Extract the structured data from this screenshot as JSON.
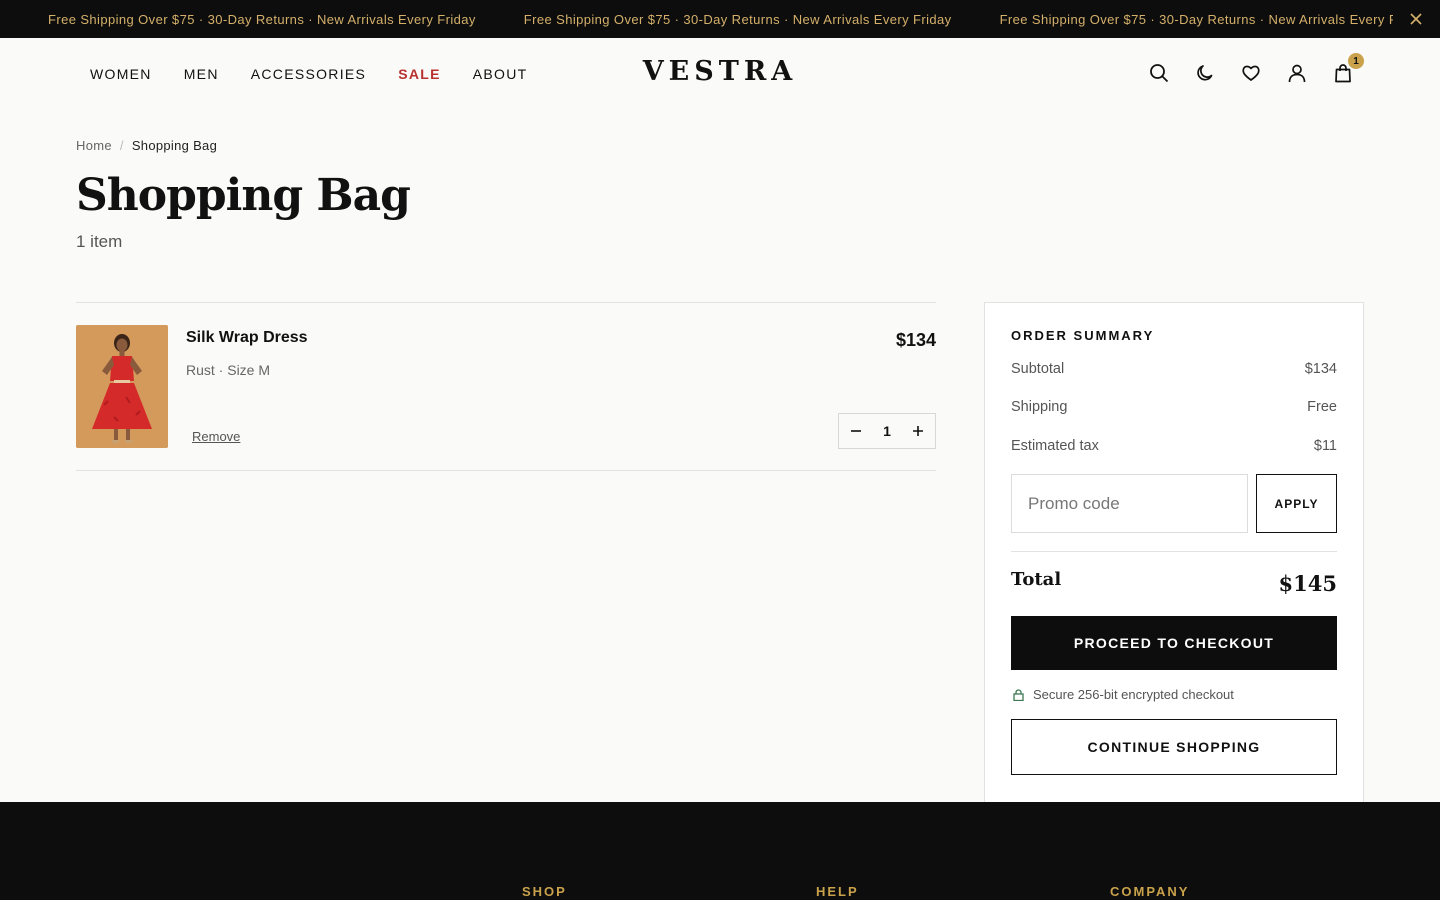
{
  "announcement": {
    "messages": [
      "Free Shipping Over $75 · 30-Day Returns · New Arrivals Every Friday",
      "Free Shipping Over $75 · 30-Day Returns · New Arrivals Every Friday",
      "Free Shipping Over $75 · 30-Day Returns · New Arrivals Every Friday"
    ],
    "close_icon": "close-icon"
  },
  "nav": {
    "items": [
      "WOMEN",
      "MEN",
      "ACCESSORIES",
      "SALE",
      "ABOUT"
    ]
  },
  "brand": {
    "logo": "VESTRA"
  },
  "header_icons": {
    "icons": [
      "search-icon",
      "moon-icon",
      "heart-icon",
      "user-icon",
      "bag-icon"
    ],
    "cart_count": "1"
  },
  "breadcrumb": {
    "home": "Home",
    "separator": "/",
    "current": "Shopping Bag"
  },
  "page": {
    "title": "Shopping Bag",
    "item_count": "1 item"
  },
  "cart": {
    "items": [
      {
        "name": "Silk Wrap Dress",
        "variant": "Rust · Size M",
        "price": "$134",
        "remove_label": "Remove",
        "quantity": "1"
      }
    ]
  },
  "summary": {
    "title": "ORDER SUMMARY",
    "rows": [
      {
        "label": "Subtotal",
        "value": "$134"
      },
      {
        "label": "Shipping",
        "value": "Free"
      },
      {
        "label": "Estimated tax",
        "value": "$11"
      }
    ],
    "promo_placeholder": "Promo code",
    "apply_label": "APPLY",
    "total_label": "Total",
    "total_value": "$145",
    "checkout_label": "PROCEED TO CHECKOUT",
    "secure_text": "Secure 256-bit encrypted checkout",
    "continue_label": "CONTINUE SHOPPING"
  },
  "footer": {
    "headings": [
      "SHOP",
      "HELP",
      "COMPANY"
    ]
  },
  "colors": {
    "accent_gold": "#d4b06a",
    "sale_red": "#b8312f",
    "dark": "#0d0d0d",
    "lock_green": "#3d7a52"
  }
}
